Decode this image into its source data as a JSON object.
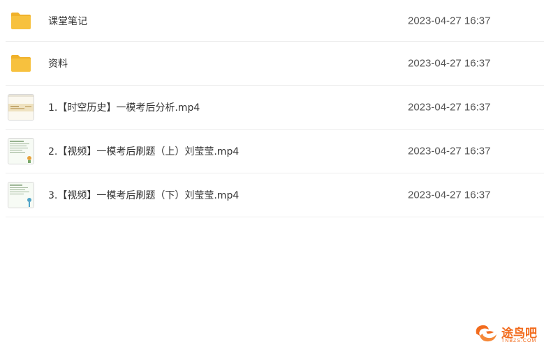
{
  "files": [
    {
      "name": "课堂笔记",
      "date": "2023-04-27 16:37",
      "icon": "folder-icon"
    },
    {
      "name": "资料",
      "date": "2023-04-27 16:37",
      "icon": "folder-icon"
    },
    {
      "name": "1.【时空历史】一模考后分析.mp4",
      "date": "2023-04-27 16:37",
      "icon": "video-thumbnail"
    },
    {
      "name": "2.【视频】一模考后刷题（上）刘莹莹.mp4",
      "date": "2023-04-27 16:37",
      "icon": "video-thumbnail"
    },
    {
      "name": "3.【视频】一模考后刷题（下）刘莹莹.mp4",
      "date": "2023-04-27 16:37",
      "icon": "video-thumbnail"
    }
  ],
  "watermark": {
    "text": "途鸟吧",
    "subtext": "TNBZS.COM",
    "color": "#f26b1d"
  },
  "colors": {
    "folder": "#f7c13e",
    "folder_tab": "#f0b12a",
    "divider": "#eeeeee",
    "date_text": "#555555"
  }
}
